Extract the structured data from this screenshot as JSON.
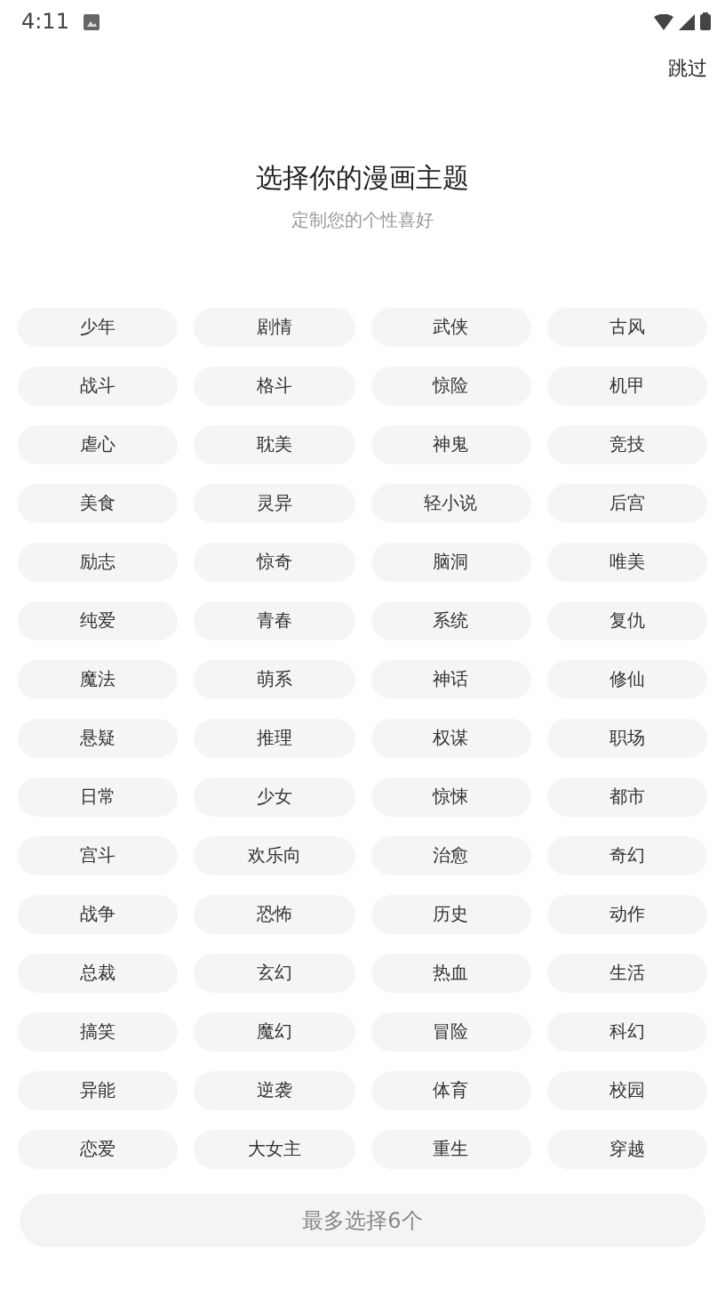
{
  "status_bar": {
    "time": "4:11"
  },
  "skip_button": "跳过",
  "title": "选择你的漫画主题",
  "subtitle": "定制您的个性喜好",
  "tags": [
    {
      "label": "少年",
      "selected": false
    },
    {
      "label": "剧情",
      "selected": false
    },
    {
      "label": "武侠",
      "selected": false
    },
    {
      "label": "古风",
      "selected": false
    },
    {
      "label": "战斗",
      "selected": false
    },
    {
      "label": "格斗",
      "selected": false
    },
    {
      "label": "惊险",
      "selected": false
    },
    {
      "label": "机甲",
      "selected": false
    },
    {
      "label": "虐心",
      "selected": false
    },
    {
      "label": "耽美",
      "selected": false
    },
    {
      "label": "神鬼",
      "selected": false
    },
    {
      "label": "竞技",
      "selected": false
    },
    {
      "label": "美食",
      "selected": false
    },
    {
      "label": "灵异",
      "selected": false
    },
    {
      "label": "轻小说",
      "selected": false
    },
    {
      "label": "后宫",
      "selected": false
    },
    {
      "label": "励志",
      "selected": false
    },
    {
      "label": "惊奇",
      "selected": false
    },
    {
      "label": "脑洞",
      "selected": false
    },
    {
      "label": "唯美",
      "selected": false
    },
    {
      "label": "纯爱",
      "selected": false
    },
    {
      "label": "青春",
      "selected": false
    },
    {
      "label": "系统",
      "selected": false
    },
    {
      "label": "复仇",
      "selected": false
    },
    {
      "label": "魔法",
      "selected": false
    },
    {
      "label": "萌系",
      "selected": false
    },
    {
      "label": "神话",
      "selected": false
    },
    {
      "label": "修仙",
      "selected": false
    },
    {
      "label": "悬疑",
      "selected": false
    },
    {
      "label": "推理",
      "selected": false
    },
    {
      "label": "权谋",
      "selected": false
    },
    {
      "label": "职场",
      "selected": false
    },
    {
      "label": "日常",
      "selected": false
    },
    {
      "label": "少女",
      "selected": false
    },
    {
      "label": "惊悚",
      "selected": false
    },
    {
      "label": "都市",
      "selected": false
    },
    {
      "label": "宫斗",
      "selected": false
    },
    {
      "label": "欢乐向",
      "selected": false
    },
    {
      "label": "治愈",
      "selected": false
    },
    {
      "label": "奇幻",
      "selected": false
    },
    {
      "label": "战争",
      "selected": false
    },
    {
      "label": "恐怖",
      "selected": false
    },
    {
      "label": "历史",
      "selected": false
    },
    {
      "label": "动作",
      "selected": false
    },
    {
      "label": "总裁",
      "selected": false
    },
    {
      "label": "玄幻",
      "selected": false
    },
    {
      "label": "热血",
      "selected": false
    },
    {
      "label": "生活",
      "selected": false
    },
    {
      "label": "搞笑",
      "selected": false
    },
    {
      "label": "魔幻",
      "selected": false
    },
    {
      "label": "冒险",
      "selected": false
    },
    {
      "label": "科幻",
      "selected": false
    },
    {
      "label": "异能",
      "selected": false
    },
    {
      "label": "逆袭",
      "selected": false
    },
    {
      "label": "体育",
      "selected": false
    },
    {
      "label": "校园",
      "selected": false
    },
    {
      "label": "恋爱",
      "selected": false
    },
    {
      "label": "大女主",
      "selected": false
    },
    {
      "label": "重生",
      "selected": false
    },
    {
      "label": "穿越",
      "selected": false
    }
  ],
  "confirm_button": {
    "label": "最多选择6个",
    "disabled": true
  }
}
